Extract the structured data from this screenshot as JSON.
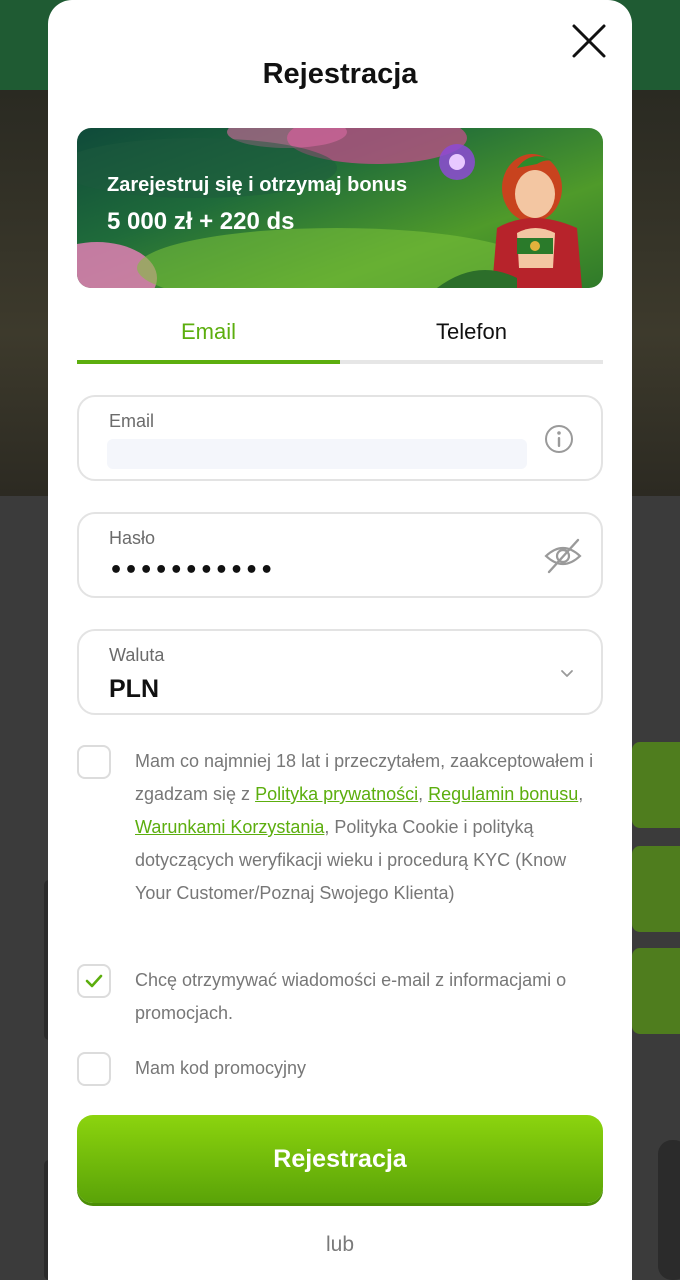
{
  "modal": {
    "title": "Rejestracja",
    "close_icon": "close-icon"
  },
  "banner": {
    "line1": "Zarejestruj się i otrzymaj bonus",
    "line2": "5 000 zł + 220 ds"
  },
  "tabs": [
    {
      "label": "Email",
      "active": true
    },
    {
      "label": "Telefon",
      "active": false
    }
  ],
  "form": {
    "email": {
      "label": "Email",
      "value": "",
      "icon": "info-icon"
    },
    "password": {
      "label": "Hasło",
      "value": "•••••••••••",
      "icon": "eye-off-icon"
    },
    "currency": {
      "label": "Waluta",
      "value": "PLN",
      "icon": "chevron-down-icon"
    }
  },
  "consents": {
    "terms": {
      "checked": false,
      "text_before": "Mam co najmniej 18 lat i przeczytałem, zaakceptowałem i zgadzam się z ",
      "link1": "Polityka prywatności",
      "sep1": ", ",
      "link2": "Regulamin bonusu",
      "sep2": ", ",
      "link3": "Warunkami Korzystania",
      "text_after": ", Polityka Cookie i polityką dotyczących weryfikacji wieku i procedurą KYC (Know Your Customer/Poznaj Swojego Klienta)"
    },
    "newsletter": {
      "checked": true,
      "text": "Chcę otrzymywać wiadomości e-mail z informacjami o promocjach."
    },
    "promo": {
      "checked": false,
      "text": "Mam kod promocyjny"
    }
  },
  "submit_label": "Rejestracja",
  "or_label": "lub",
  "colors": {
    "accent": "#5cae0e",
    "button_top": "#8cd40e",
    "button_bottom": "#5aa308"
  }
}
